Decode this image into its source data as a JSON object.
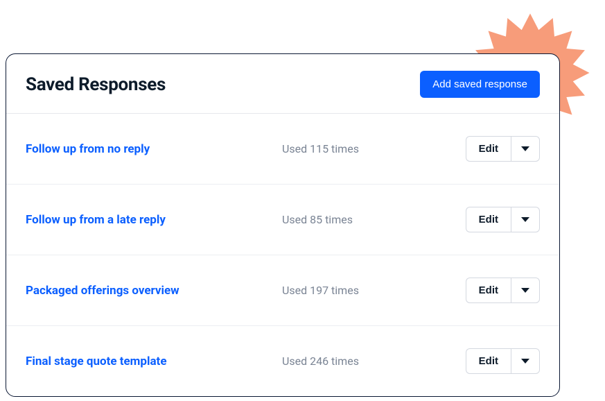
{
  "decoration": {
    "starburst_color": "#f79c7a"
  },
  "header": {
    "title": "Saved Responses",
    "add_button_label": "Add saved response"
  },
  "rows": [
    {
      "name": "Follow up from no reply",
      "usage": "Used 115 times",
      "edit_label": "Edit"
    },
    {
      "name": "Follow up from a late reply",
      "usage": "Used 85 times",
      "edit_label": "Edit"
    },
    {
      "name": "Packaged offerings overview",
      "usage": "Used 197 times",
      "edit_label": "Edit"
    },
    {
      "name": "Final stage quote template",
      "usage": "Used 246 times",
      "edit_label": "Edit"
    }
  ]
}
